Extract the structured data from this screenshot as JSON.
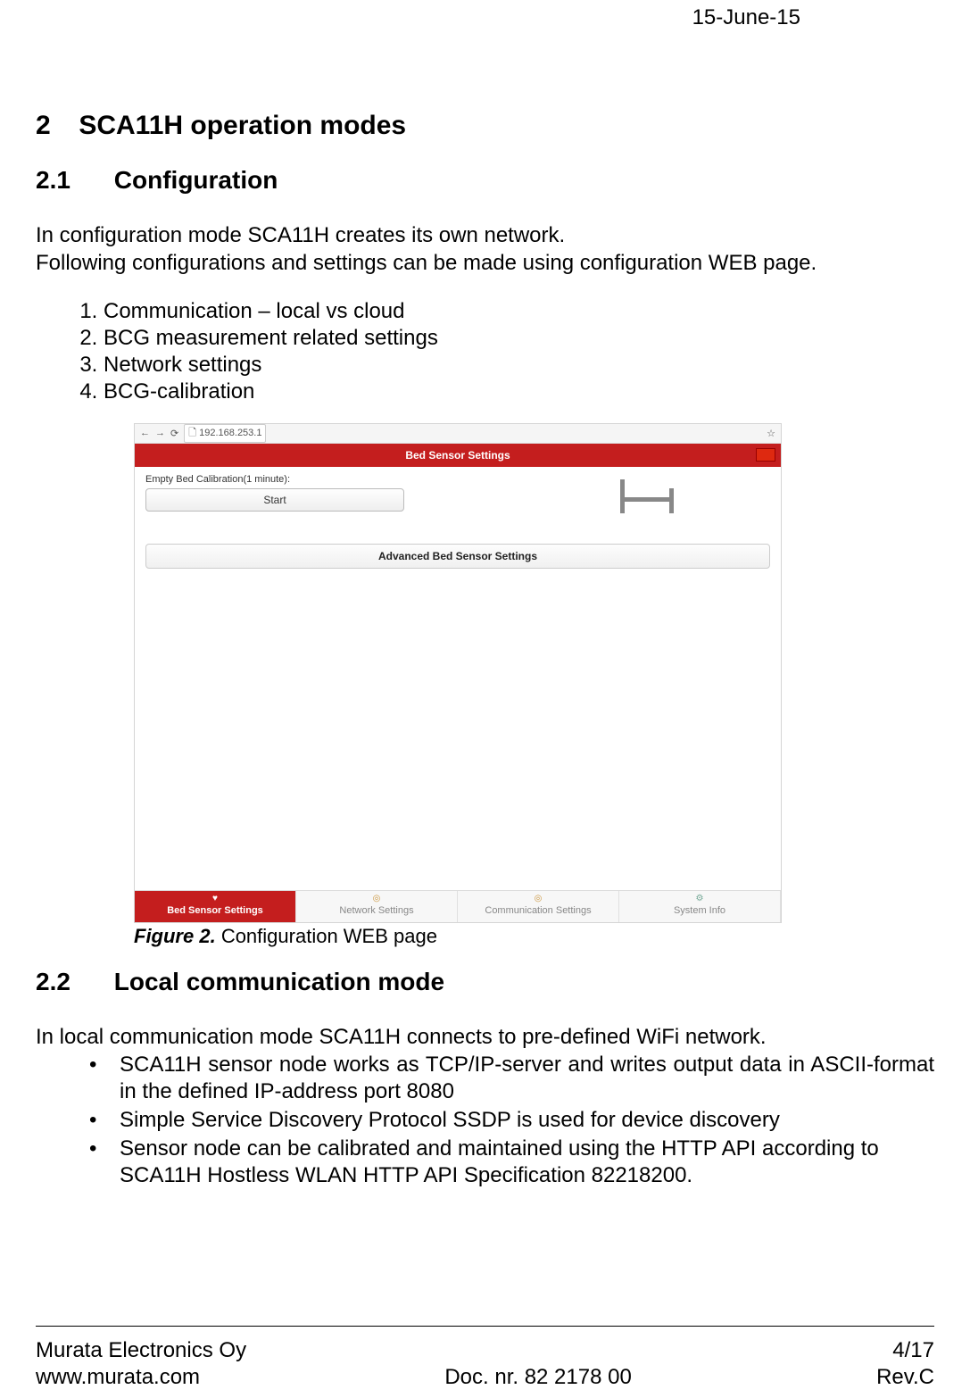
{
  "header": {
    "date": "15-June-15"
  },
  "section2": {
    "num": "2",
    "title": "SCA11H operation modes",
    "s21": {
      "num": "2.1",
      "title": "Configuration",
      "p1": "In configuration mode SCA11H creates its own network.",
      "p2": "Following configurations and settings can be made using configuration WEB page.",
      "list": [
        "Communication – local vs cloud",
        "BCG measurement related settings",
        "Network settings",
        "BCG-calibration"
      ]
    },
    "figure2": {
      "label": "Figure 2.",
      "caption": "Configuration WEB page",
      "screenshot": {
        "url": "192.168.253.1",
        "header_title": "Bed Sensor Settings",
        "calib_label": "Empty Bed Calibration(1 minute):",
        "start_btn": "Start",
        "accordion": "Advanced Bed Sensor Settings",
        "tabs": [
          "Bed Sensor Settings",
          "Network Settings",
          "Communication Settings",
          "System Info"
        ]
      }
    },
    "s22": {
      "num": "2.2",
      "title": "Local communication mode",
      "p1": "In local communication mode SCA11H connects to pre-defined WiFi network.",
      "bullets": [
        "SCA11H sensor node works as TCP/IP-server and writes output data in ASCII-format in the defined IP-address port 8080",
        "Simple Service Discovery Protocol SSDP is used for device discovery",
        "Sensor node can be calibrated and maintained using the HTTP API according to SCA11H Hostless WLAN HTTP API Specification 82218200."
      ]
    }
  },
  "footer": {
    "company": "Murata Electronics Oy",
    "website": "www.murata.com",
    "docnr": "Doc. nr. 82 2178 00",
    "page": "4/17",
    "rev": "Rev.C"
  }
}
